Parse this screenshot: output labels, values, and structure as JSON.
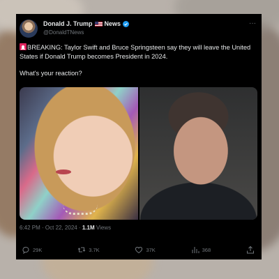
{
  "tweet": {
    "author_name": "Donald J. Trump",
    "author_suffix": "News",
    "handle": "@DonaldTNews",
    "text_line1": "BREAKING: Taylor Swift and Bruce Springsteen say they will leave the United States if Donald Trump becomes President in 2024.",
    "text_line2": "What's your reaction?",
    "timestamp": "6:42 PM · Oct 22, 2024 ·",
    "views_count": "1.1M",
    "views_label": "Views",
    "replies": "29K",
    "reposts": "3.7K",
    "likes": "37K",
    "bookmarks": "368"
  },
  "colors": {
    "card_bg": "#000000",
    "text": "#e7e9ea",
    "muted": "#71767b",
    "verified": "#1d9bf0",
    "siren": "#e0245e"
  },
  "icons": [
    "more-icon",
    "verified-icon",
    "flag-icon",
    "siren-icon",
    "reply-icon",
    "repost-icon",
    "like-icon",
    "views-icon",
    "share-icon"
  ]
}
